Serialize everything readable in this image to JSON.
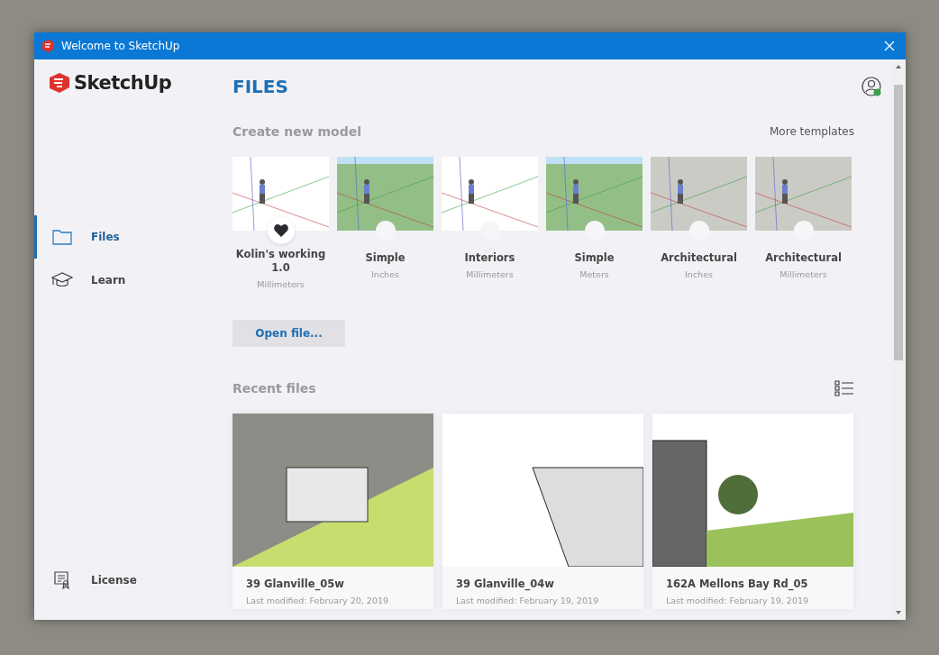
{
  "window": {
    "title": "Welcome to SketchUp"
  },
  "logo": {
    "text": "SketchUp"
  },
  "sidebar": {
    "items": [
      {
        "label": "Files",
        "selected": true
      },
      {
        "label": "Learn",
        "selected": false
      }
    ],
    "footer": {
      "label": "License"
    }
  },
  "page_title": "FILES",
  "create": {
    "heading": "Create new model",
    "more_link": "More templates",
    "templates": [
      {
        "name": "Kolin's working 1.0",
        "units": "Millimeters",
        "kind": "white",
        "favorite": true
      },
      {
        "name": "Simple",
        "units": "Inches",
        "kind": "green",
        "favorite": false
      },
      {
        "name": "Interiors",
        "units": "Millimeters",
        "kind": "white",
        "favorite": false
      },
      {
        "name": "Simple",
        "units": "Meters",
        "kind": "green",
        "favorite": false
      },
      {
        "name": "Architectural",
        "units": "Inches",
        "kind": "gray",
        "favorite": false
      },
      {
        "name": "Architectural",
        "units": "Millimeters",
        "kind": "gray",
        "favorite": false
      }
    ],
    "open_button": "Open file..."
  },
  "recent": {
    "heading": "Recent files",
    "files": [
      {
        "name": "39 Glanville_05w",
        "modified": "Last modified: February 20, 2019"
      },
      {
        "name": "39 Glanville_04w",
        "modified": "Last modified: February 19, 2019"
      },
      {
        "name": "162A Mellons Bay Rd_05",
        "modified": "Last modified: February 19, 2019"
      }
    ]
  }
}
